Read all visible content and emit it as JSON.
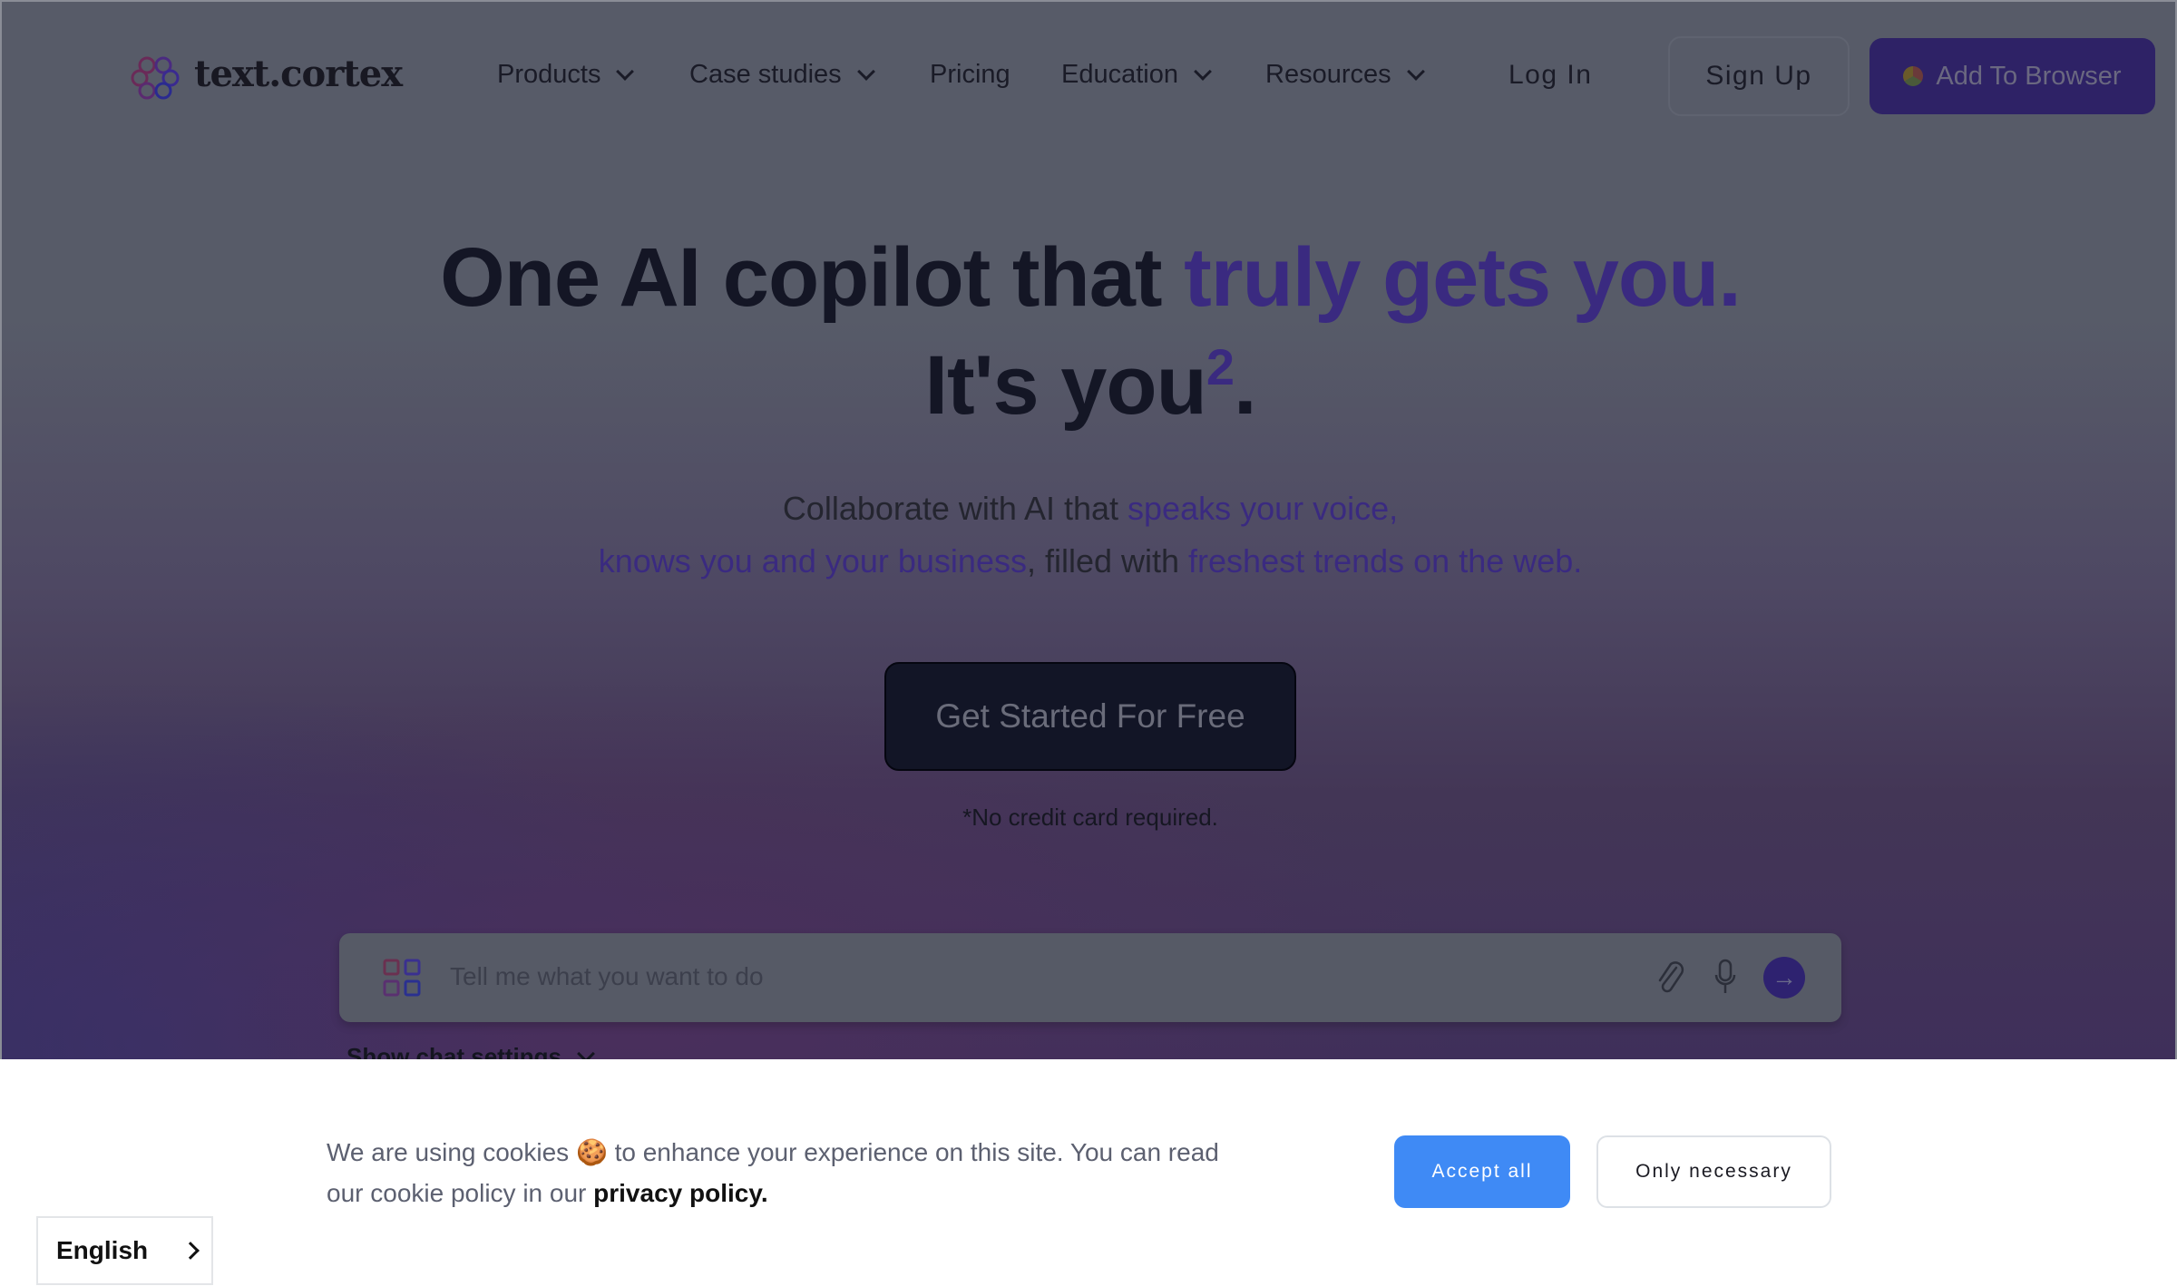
{
  "header": {
    "logo": "text.cortex",
    "nav": [
      {
        "label": "Products",
        "dropdown": true
      },
      {
        "label": "Case studies",
        "dropdown": true
      },
      {
        "label": "Pricing",
        "dropdown": false
      },
      {
        "label": "Education",
        "dropdown": true
      },
      {
        "label": "Resources",
        "dropdown": true
      }
    ],
    "login": "Log In",
    "signup": "Sign Up",
    "add_browser": "Add To Browser"
  },
  "hero": {
    "title_a": "One AI copilot that ",
    "title_b": "truly gets you.",
    "title_c": "It's you",
    "title_sup": "2",
    "title_d": ".",
    "sub_a": "Collaborate with AI that ",
    "sub_b": "speaks your voice,",
    "sub_c": "knows you and your business",
    ", ": "",
    "sub_d": ", filled with ",
    "sub_e": "freshest trends on the web.",
    "cta": "Get Started For Free",
    "note": "*No credit card required."
  },
  "chat": {
    "placeholder": "Tell me what you want to do",
    "settings": "Show chat settings"
  },
  "cookie": {
    "text": "We are using cookies 🍪 to enhance your experience on this site. You can read our cookie policy in our ",
    "link": "privacy policy.",
    "accept": "Accept all",
    "necessary": "Only necessary"
  },
  "language": {
    "current": "English"
  },
  "colors": {
    "accent": "#3a2a80",
    "accept": "#3f8af5",
    "overlay": "#575b68"
  }
}
